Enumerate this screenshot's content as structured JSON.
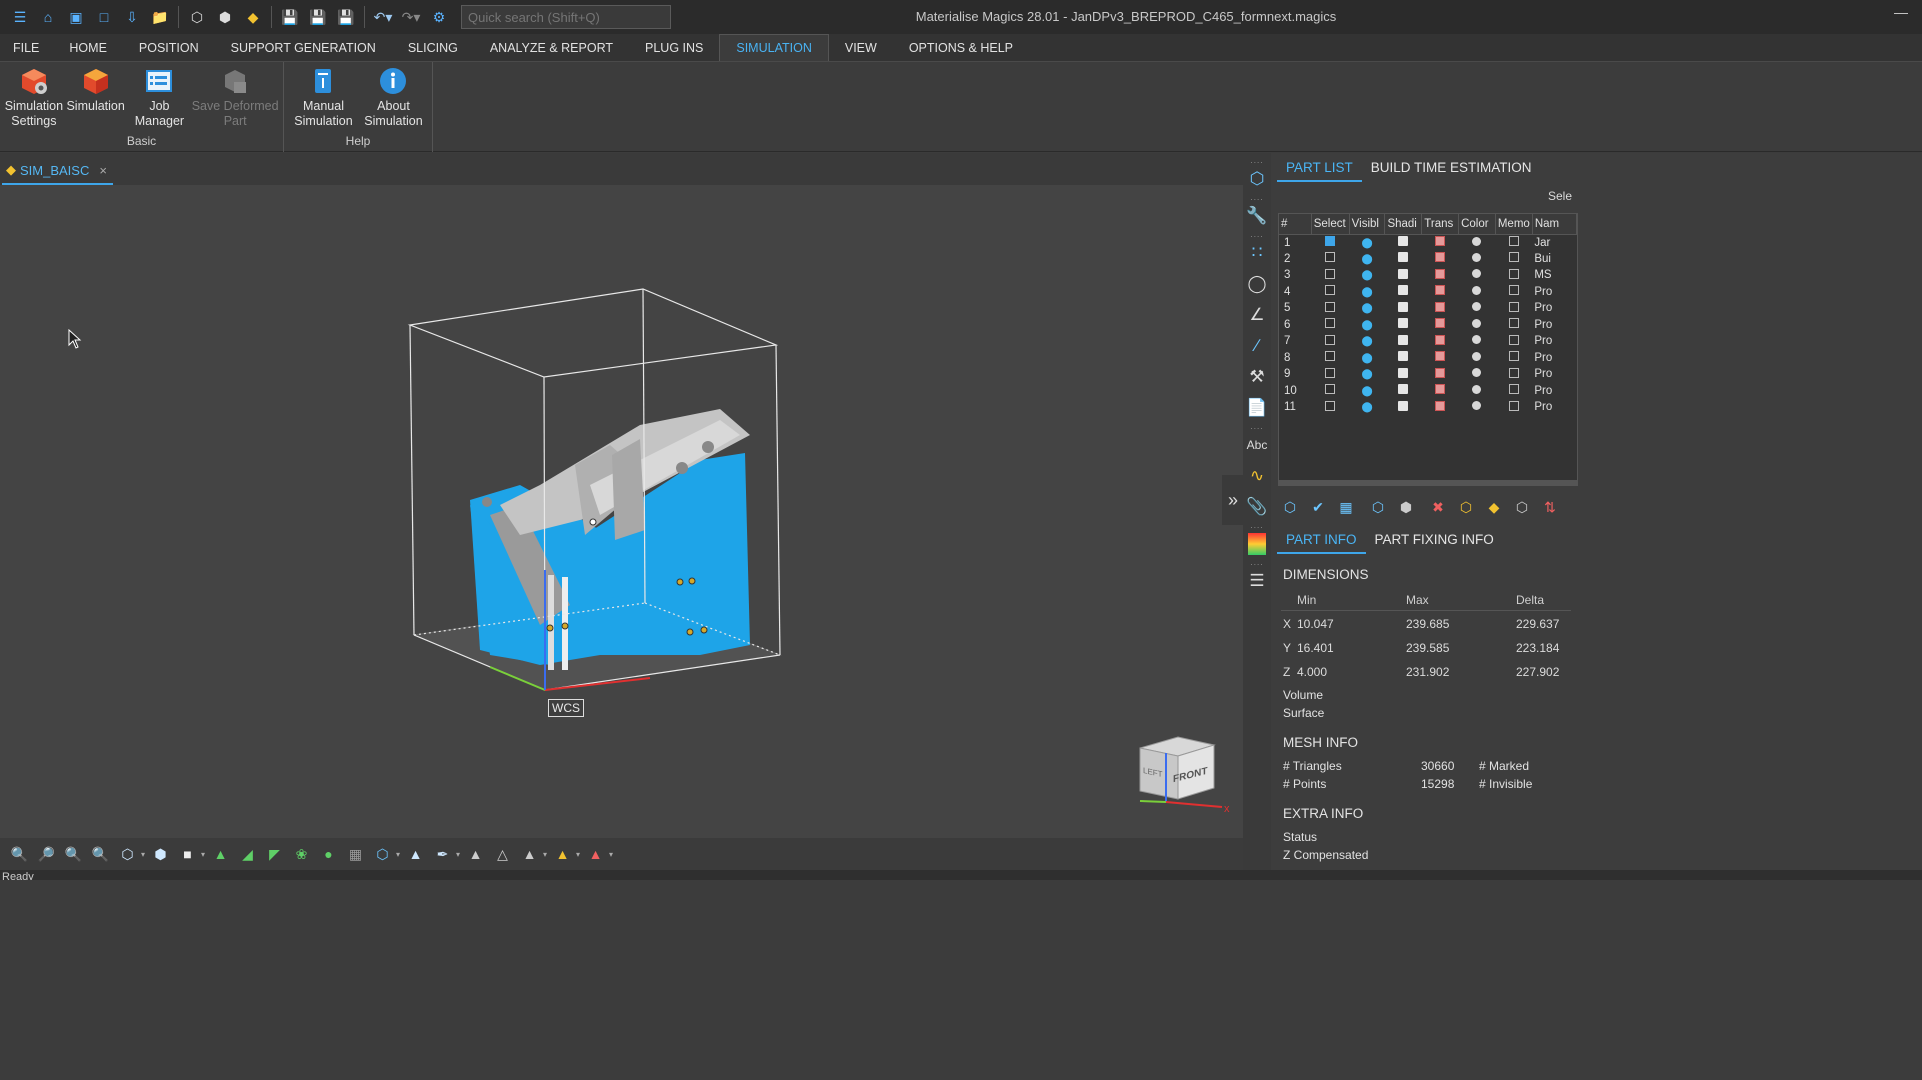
{
  "titlebar": {
    "title": "Materialise Magics 28.01 - JanDPv3_BREPROD_C465_formnext.magics",
    "search_placeholder": "Quick search (Shift+Q)",
    "minimize": "—",
    "quick_icons": [
      "app-menu-icon",
      "home-icon",
      "open-icon",
      "new-icon",
      "import-icon",
      "folder-icon",
      "part-icon",
      "cube-icon",
      "label-icon",
      "save-icon",
      "save-as-icon",
      "save-all-icon",
      "undo-icon",
      "redo-icon",
      "settings-icon"
    ]
  },
  "ribbon": {
    "tabs": [
      "FILE",
      "HOME",
      "POSITION",
      "SUPPORT GENERATION",
      "SLICING",
      "ANALYZE & REPORT",
      "PLUG INS",
      "SIMULATION",
      "VIEW",
      "OPTIONS & HELP"
    ],
    "active_tab": "SIMULATION",
    "groups": [
      {
        "label": "Basic",
        "buttons": [
          {
            "label": "Simulation Settings",
            "icon": "simulation-settings-icon",
            "enabled": true
          },
          {
            "label": "Simulation",
            "icon": "simulation-icon",
            "enabled": true
          },
          {
            "label": "Job Manager",
            "icon": "job-manager-icon",
            "enabled": true
          },
          {
            "label": "Save Deformed Part",
            "icon": "save-deformed-part-icon",
            "enabled": false
          }
        ]
      },
      {
        "label": "Help",
        "buttons": [
          {
            "label": "Manual Simulation",
            "icon": "manual-icon",
            "enabled": true
          },
          {
            "label": "About Simulation",
            "icon": "info-icon",
            "enabled": true
          }
        ]
      }
    ]
  },
  "document": {
    "tab_label": "SIM_BAISC",
    "close": "×"
  },
  "viewport": {
    "wcs_label": "WCS",
    "cube_front": "FRONT",
    "cube_left": "LEFT",
    "collapse": "»",
    "part_color": "#1ea4e8",
    "axis_colors": {
      "x": "#e03030",
      "y": "#7ad03a",
      "z": "#3a6cf0"
    }
  },
  "bottom_toolbar": {
    "tools": [
      "zoom-icon",
      "zoom-window-icon",
      "zoom-selected-icon",
      "zoom-fit-icon",
      "view-box-icon",
      "iso-view-icon",
      "shaded-icon",
      "select-triangle-icon",
      "select-surface-icon",
      "select-shell-icon",
      "lasso-icon",
      "sphere-icon",
      "mesh-icon",
      "part-box-icon",
      "mark-icon",
      "mark-brush-icon",
      "mark-plane-icon",
      "mark-outline-icon",
      "mark-dropdown-icon",
      "mark-yellow-icon",
      "mark-red-icon"
    ]
  },
  "status_bar": {
    "text": "Ready"
  },
  "vertical_tools": [
    "part-cube-icon",
    "wrench-icon",
    "points-icon",
    "measure-circle-icon",
    "measure-angle-icon",
    "measure-info-icon",
    "tools-icon",
    "page-icon",
    "abc-icon",
    "wave-icon",
    "clip-icon",
    "color-scale-icon",
    "layers-icon"
  ],
  "right_panel": {
    "top_tabs": [
      "PART LIST",
      "BUILD TIME ESTIMATION"
    ],
    "active_top_tab": "PART LIST",
    "select_label": "Sele",
    "table": {
      "columns": [
        "#",
        "Select",
        "Visibl",
        "Shadi",
        "Trans",
        "Color",
        "Memo",
        "Nam"
      ],
      "rows": [
        {
          "n": "1",
          "selected": true,
          "name": "Jar"
        },
        {
          "n": "2",
          "selected": false,
          "name": "Bui"
        },
        {
          "n": "3",
          "selected": false,
          "name": "MS"
        },
        {
          "n": "4",
          "selected": false,
          "name": "Pro"
        },
        {
          "n": "5",
          "selected": false,
          "name": "Pro"
        },
        {
          "n": "6",
          "selected": false,
          "name": "Pro"
        },
        {
          "n": "7",
          "selected": false,
          "name": "Pro"
        },
        {
          "n": "8",
          "selected": false,
          "name": "Pro"
        },
        {
          "n": "9",
          "selected": false,
          "name": "Pro"
        },
        {
          "n": "10",
          "selected": false,
          "name": "Pro"
        },
        {
          "n": "11",
          "selected": false,
          "name": "Pro"
        }
      ]
    },
    "part_tools": [
      "add-part-icon",
      "select-part-icon",
      "part-list-icon",
      "copy-part-icon",
      "merge-part-icon",
      "delete-part-icon",
      "part-color-icon",
      "label-part-icon",
      "part-box-icon",
      "sort-icon"
    ],
    "info_tabs": [
      "PART INFO",
      "PART FIXING INFO"
    ],
    "active_info_tab": "PART INFO",
    "dimensions": {
      "title": "DIMENSIONS",
      "headers": [
        "Min",
        "Max",
        "Delta"
      ],
      "rows": [
        {
          "axis": "X",
          "min": "10.047",
          "max": "239.685",
          "delta": "229.637"
        },
        {
          "axis": "Y",
          "min": "16.401",
          "max": "239.585",
          "delta": "223.184"
        },
        {
          "axis": "Z",
          "min": "4.000",
          "max": "231.902",
          "delta": "227.902"
        }
      ],
      "volume_label": "Volume",
      "surface_label": "Surface"
    },
    "mesh_info": {
      "title": "MESH INFO",
      "triangles_label": "# Triangles",
      "triangles": "30660",
      "points_label": "# Points",
      "points": "15298",
      "marked_label": "# Marked",
      "invisible_label": "# Invisible"
    },
    "extra_info": {
      "title": "EXTRA INFO",
      "status_label": "Status",
      "z_comp_label": "Z Compensated"
    }
  }
}
